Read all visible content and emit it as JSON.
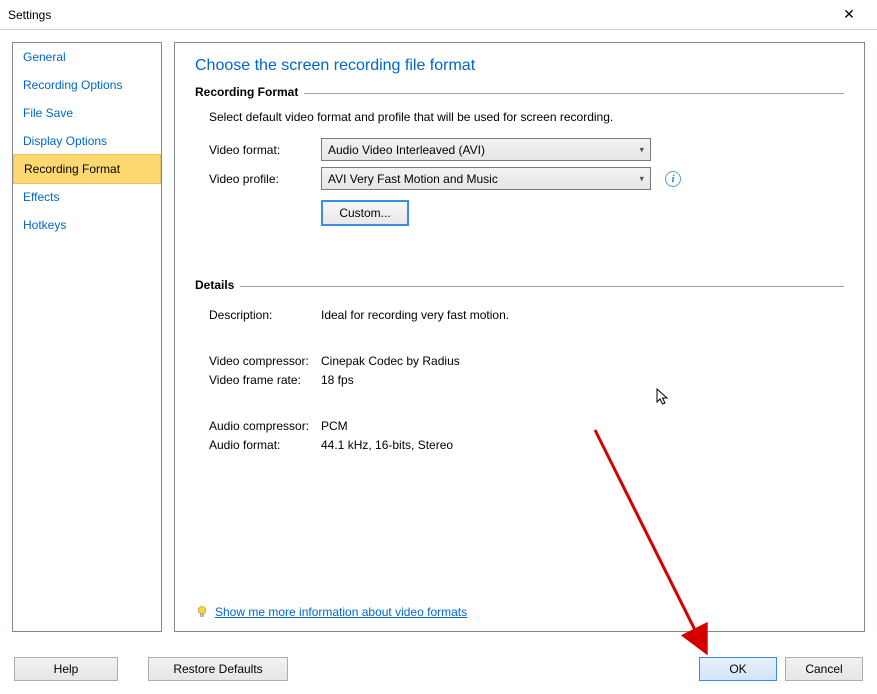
{
  "window": {
    "title": "Settings"
  },
  "sidebar": {
    "items": [
      {
        "label": "General"
      },
      {
        "label": "Recording Options"
      },
      {
        "label": "File Save"
      },
      {
        "label": "Display Options"
      },
      {
        "label": "Recording Format"
      },
      {
        "label": "Effects"
      },
      {
        "label": "Hotkeys"
      }
    ],
    "selected_index": 4
  },
  "page": {
    "title": "Choose the screen recording file format",
    "recording_format": {
      "legend": "Recording Format",
      "intro": "Select default video format and profile that will be used for screen recording.",
      "video_format_label": "Video format:",
      "video_format_value": "Audio Video Interleaved (AVI)",
      "video_profile_label": "Video profile:",
      "video_profile_value": "AVI Very Fast Motion and Music",
      "custom_button": "Custom..."
    },
    "details": {
      "legend": "Details",
      "rows": {
        "description_label": "Description:",
        "description_value": "Ideal for recording very fast motion.",
        "video_compressor_label": "Video compressor:",
        "video_compressor_value": "Cinepak Codec by Radius",
        "video_frame_rate_label": "Video frame rate:",
        "video_frame_rate_value": "18 fps",
        "audio_compressor_label": "Audio compressor:",
        "audio_compressor_value": "PCM",
        "audio_format_label": "Audio format:",
        "audio_format_value": "44.1 kHz, 16-bits, Stereo"
      }
    },
    "help_link": "Show me more information about video formats"
  },
  "footer": {
    "help": "Help",
    "restore": "Restore Defaults",
    "ok": "OK",
    "cancel": "Cancel"
  }
}
